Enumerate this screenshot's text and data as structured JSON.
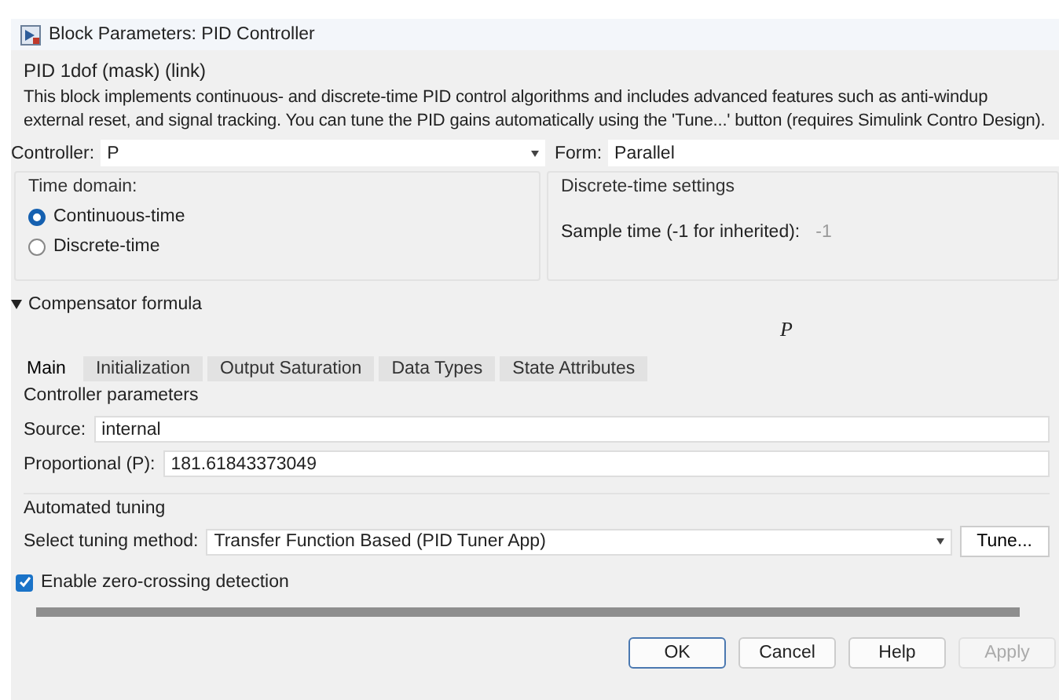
{
  "window": {
    "title": "Block Parameters: PID Controller"
  },
  "mask_title": "PID 1dof (mask) (link)",
  "description": "This block implements continuous- and discrete-time PID control algorithms and includes advanced features such as anti-windup external reset, and signal tracking. You can tune the PID gains automatically using the 'Tune...' button (requires Simulink Contro Design).",
  "controller": {
    "label": "Controller:",
    "value": "P"
  },
  "form": {
    "label": "Form:",
    "value": "Parallel"
  },
  "time_domain": {
    "title": "Time domain:",
    "options": [
      {
        "label": "Continuous-time",
        "selected": true
      },
      {
        "label": "Discrete-time",
        "selected": false
      }
    ]
  },
  "discrete_settings": {
    "title": "Discrete-time settings",
    "sample_time": {
      "label": "Sample time (-1 for inherited):",
      "value": "-1",
      "disabled": true
    }
  },
  "compensator": {
    "label": "Compensator formula",
    "expanded": true,
    "formula": "P"
  },
  "tabs": [
    {
      "label": "Main",
      "selected": true
    },
    {
      "label": "Initialization",
      "selected": false
    },
    {
      "label": "Output Saturation",
      "selected": false
    },
    {
      "label": "Data Types",
      "selected": false
    },
    {
      "label": "State Attributes",
      "selected": false
    }
  ],
  "controller_parameters": {
    "title": "Controller parameters",
    "source": {
      "label": "Source:",
      "value": "internal"
    },
    "proportional": {
      "label": "Proportional (P):",
      "value": "181.61843373049"
    }
  },
  "automated_tuning": {
    "title": "Automated tuning",
    "method": {
      "label": "Select tuning method:",
      "value": "Transfer Function Based (PID Tuner App)"
    },
    "tune_button": "Tune..."
  },
  "zero_crossing": {
    "label": "Enable zero-crossing detection",
    "checked": true
  },
  "buttons": [
    {
      "label": "OK",
      "disabled": false,
      "default": true
    },
    {
      "label": "Cancel",
      "disabled": false,
      "default": false
    },
    {
      "label": "Help",
      "disabled": false,
      "default": false
    },
    {
      "label": "Apply",
      "disabled": true,
      "default": false
    }
  ]
}
